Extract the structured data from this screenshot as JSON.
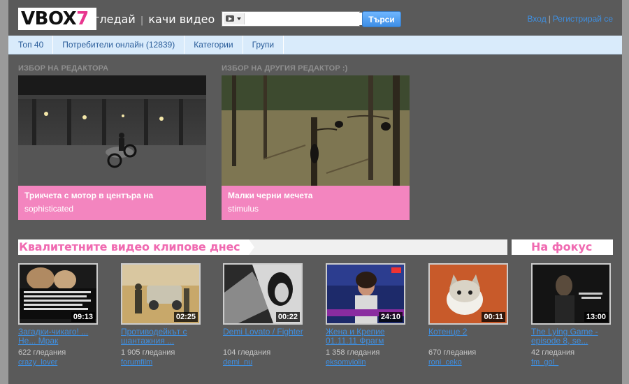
{
  "header": {
    "logo_main": "VBOX",
    "logo_num": "7",
    "tagline_watch": "гледай",
    "tagline_sep": "|",
    "tagline_upload": "качи видео",
    "search_value": "",
    "search_button": "Търси",
    "login": "Вход",
    "auth_sep": "|",
    "register": "Регистрирай се"
  },
  "nav": {
    "items": [
      {
        "label": "Топ 40"
      },
      {
        "label": "Потребители онлайн (12839)"
      },
      {
        "label": "Категории"
      },
      {
        "label": "Групи"
      }
    ]
  },
  "editor_picks": [
    {
      "heading": "ИЗБОР НА РЕДАКТОРА",
      "title": "Трикчета с мотор в центъра на",
      "user": "sophisticated"
    },
    {
      "heading": "ИЗБОР НА ДРУГИЯ РЕДАКТОР :)",
      "title": "Малки черни мечета",
      "user": "stimulus"
    }
  ],
  "sections": {
    "quality": "Квалитетните видео клипове днес",
    "focus": "На фокус"
  },
  "videos": [
    {
      "title": "Загадки-чикаго! ... Не... Мрак",
      "duration": "09:13",
      "views": "622 гледания",
      "user": "crazy_lover"
    },
    {
      "title": "Противодейкът с шантажния ...",
      "duration": "02:25",
      "views": "1 905 гледания",
      "user": "forumfilm"
    },
    {
      "title": "Demi Lovato / Fighter",
      "duration": "00:22",
      "views": "104 гледания",
      "user": "demi_nu"
    },
    {
      "title": "Жена и Крепие 01.11.11 Фрагм",
      "duration": "24:10",
      "views": "1 358 гледания",
      "user": "eksomviolin"
    },
    {
      "title": "Котенце 2",
      "duration": "00:11",
      "views": "670 гледания",
      "user": "roni_ceko"
    },
    {
      "title": "The Lying Game - episode 8, se...",
      "duration": "13:00",
      "views": "42 гледания",
      "user": "fm_gol_"
    }
  ]
}
